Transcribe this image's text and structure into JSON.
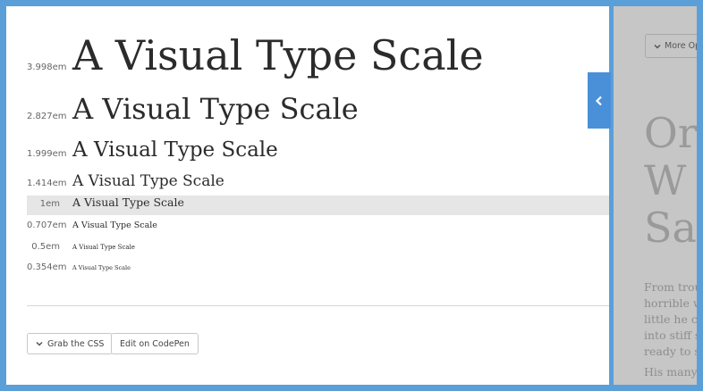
{
  "type_scale": {
    "rows": [
      {
        "size_label": "3.998em",
        "sample": "A Visual Type Scale"
      },
      {
        "size_label": "2.827em",
        "sample": "A Visual Type Scale"
      },
      {
        "size_label": "1.999em",
        "sample": "A Visual Type Scale"
      },
      {
        "size_label": "1.414em",
        "sample": "A Visual Type Scale"
      },
      {
        "size_label": "1em",
        "sample": "A Visual Type Scale"
      },
      {
        "size_label": "0.707em",
        "sample": "A Visual Type Scale"
      },
      {
        "size_label": "0.5em",
        "sample": "A Visual Type Scale"
      },
      {
        "size_label": "0.354em",
        "sample": "A Visual Type Scale"
      }
    ]
  },
  "actions": {
    "grab_css_label": "Grab the CSS",
    "codepen_label": "Edit on CodePen"
  },
  "side_panel": {
    "more_options_label": "More Op",
    "heading_lines": [
      "Or",
      "W",
      "Sa"
    ],
    "para_lines": [
      "From trou",
      "horrible w",
      "little he co",
      "into stiff s",
      "ready to s"
    ],
    "para2_line": "His many"
  },
  "icons": {
    "collapse_tab": "chevron-left-icon",
    "grab_css": "chevron-down-icon",
    "more_options": "chevron-down-icon"
  },
  "colors": {
    "frame": "#5b9fd9",
    "tab": "#4a90d9",
    "highlight_row": "#e6e6e6",
    "side_panel": "#c6c6c6"
  }
}
